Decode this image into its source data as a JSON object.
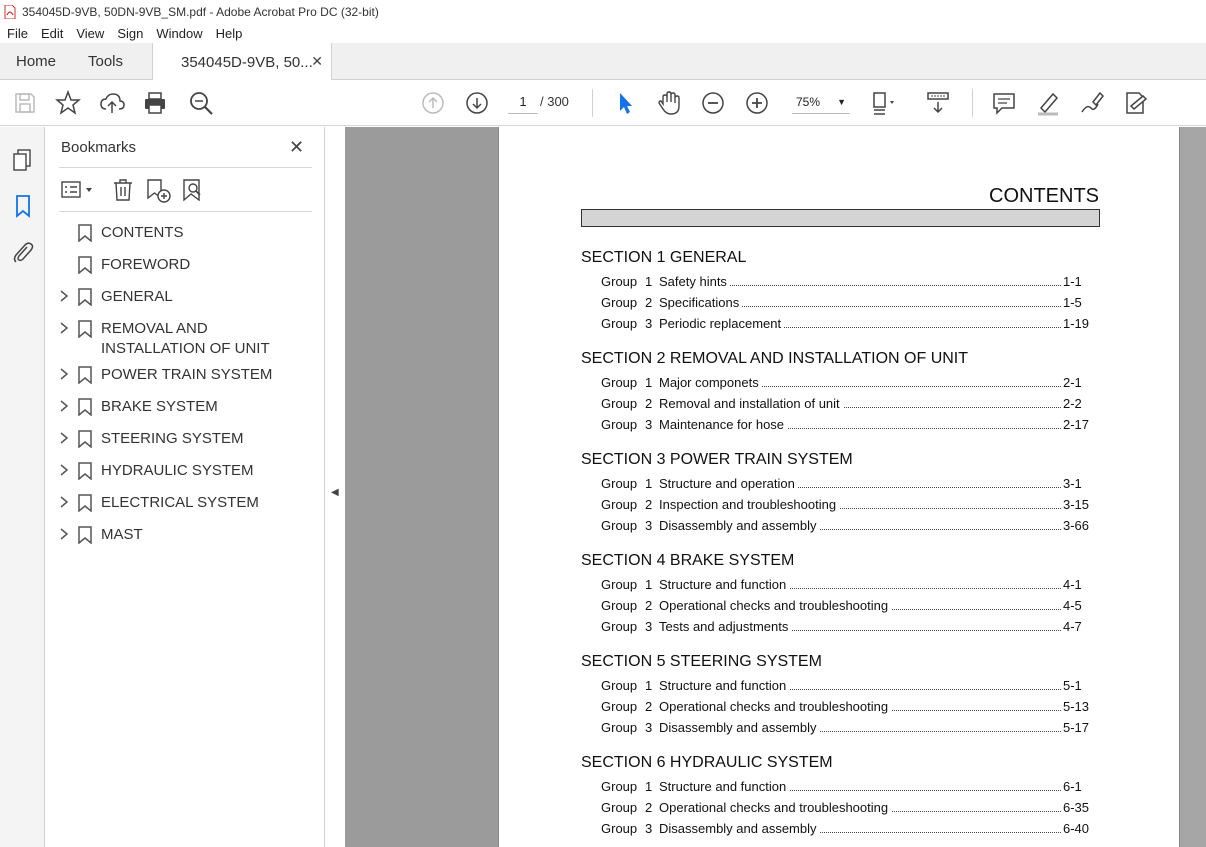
{
  "window": {
    "title": "354045D-9VB, 50DN-9VB_SM.pdf - Adobe Acrobat Pro DC (32-bit)"
  },
  "menu": [
    "File",
    "Edit",
    "View",
    "Sign",
    "Window",
    "Help"
  ],
  "tabs": {
    "home": "Home",
    "tools": "Tools",
    "doc": "354045D-9VB, 50..."
  },
  "toolbar": {
    "page_current": "1",
    "page_total": "/ 300",
    "zoom": "75%"
  },
  "bookmarks_panel": {
    "title": "Bookmarks",
    "items": [
      {
        "label": "CONTENTS",
        "expandable": false
      },
      {
        "label": "FOREWORD",
        "expandable": false
      },
      {
        "label": "GENERAL",
        "expandable": true
      },
      {
        "label": "REMOVAL AND INSTALLATION OF UNIT",
        "expandable": true
      },
      {
        "label": "POWER TRAIN SYSTEM",
        "expandable": true
      },
      {
        "label": "BRAKE SYSTEM",
        "expandable": true
      },
      {
        "label": "STEERING SYSTEM",
        "expandable": true
      },
      {
        "label": "HYDRAULIC SYSTEM",
        "expandable": true
      },
      {
        "label": "ELECTRICAL SYSTEM",
        "expandable": true
      },
      {
        "label": "MAST",
        "expandable": true
      }
    ]
  },
  "document": {
    "heading": "CONTENTS",
    "sections": [
      {
        "title": "SECTION 1  GENERAL",
        "groups": [
          {
            "group": "Group",
            "num": "1",
            "text": "Safety hints",
            "page": "1-1"
          },
          {
            "group": "Group",
            "num": "2",
            "text": "Specifications",
            "page": "1-5"
          },
          {
            "group": "Group",
            "num": "3",
            "text": "Periodic replacement",
            "page": "1-19"
          }
        ]
      },
      {
        "title": "SECTION 2  REMOVAL AND INSTALLATION OF UNIT",
        "groups": [
          {
            "group": "Group",
            "num": "1",
            "text": "Major componets",
            "page": "2-1"
          },
          {
            "group": "Group",
            "num": "2",
            "text": "Removal and installation of unit",
            "page": "2-2"
          },
          {
            "group": "Group",
            "num": "3",
            "text": "Maintenance for hose",
            "page": "2-17"
          }
        ]
      },
      {
        "title": "SECTION 3  POWER TRAIN SYSTEM",
        "groups": [
          {
            "group": "Group",
            "num": "1",
            "text": "Structure and operation",
            "page": "3-1"
          },
          {
            "group": "Group",
            "num": "2",
            "text": "Inspection and troubleshooting",
            "page": "3-15"
          },
          {
            "group": "Group",
            "num": "3",
            "text": "Disassembly and assembly",
            "page": "3-66"
          }
        ]
      },
      {
        "title": "SECTION 4  BRAKE SYSTEM",
        "groups": [
          {
            "group": "Group",
            "num": "1",
            "text": "Structure and function",
            "page": "4-1"
          },
          {
            "group": "Group",
            "num": "2",
            "text": "Operational checks and troubleshooting",
            "page": "4-5"
          },
          {
            "group": "Group",
            "num": "3",
            "text": "Tests and adjustments",
            "page": "4-7"
          }
        ]
      },
      {
        "title": "SECTION 5  STEERING SYSTEM",
        "groups": [
          {
            "group": "Group",
            "num": "1",
            "text": "Structure and function",
            "page": "5-1"
          },
          {
            "group": "Group",
            "num": "2",
            "text": "Operational checks and troubleshooting",
            "page": "5-13"
          },
          {
            "group": "Group",
            "num": "3",
            "text": "Disassembly and assembly",
            "page": "5-17"
          }
        ]
      },
      {
        "title": "SECTION 6  HYDRAULIC SYSTEM",
        "groups": [
          {
            "group": "Group",
            "num": "1",
            "text": "Structure and function",
            "page": "6-1"
          },
          {
            "group": "Group",
            "num": "2",
            "text": "Operational checks and troubleshooting",
            "page": "6-35"
          },
          {
            "group": "Group",
            "num": "3",
            "text": "Disassembly and assembly",
            "page": "6-40"
          }
        ]
      }
    ]
  },
  "colors": {
    "accent": "#1473e6",
    "viewer_bg": "#9b9b9b"
  },
  "icons": [
    "pdf-file-icon",
    "save-icon",
    "bookmark-star-icon",
    "upload-icon",
    "print-icon",
    "search-zoom-icon",
    "page-up-icon",
    "page-down-icon",
    "select-arrow-icon",
    "hand-icon",
    "zoom-out-icon",
    "zoom-in-icon",
    "page-fit-icon",
    "scroll-mode-icon",
    "comment-icon",
    "highlight-icon",
    "draw-icon",
    "fill-sign-icon",
    "pages-thumbnail-icon",
    "bookmarks-icon",
    "attachment-icon",
    "close-icon",
    "options-icon",
    "delete-icon",
    "new-bookmark-icon",
    "find-bookmark-icon",
    "chevron-right-icon",
    "bookmark-flag-icon",
    "collapse-panel-icon"
  ]
}
